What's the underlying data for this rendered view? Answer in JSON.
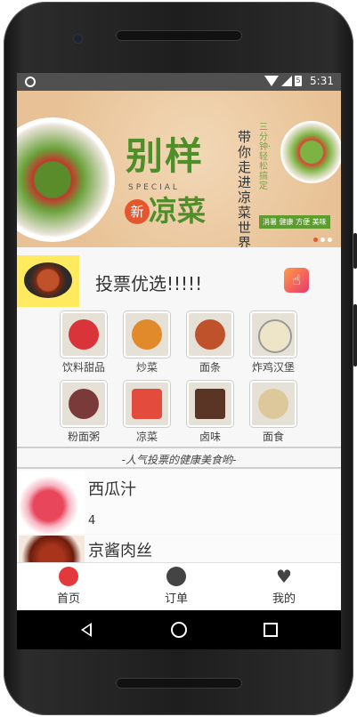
{
  "status_bar": {
    "time": "5:31",
    "battery": "5"
  },
  "banner": {
    "title": "别样",
    "subtitle": "凉菜",
    "special": "SPECIAL",
    "badge": "新",
    "vertical_text": "带你走进凉菜世界",
    "vertical_small": "三分钟·轻松搞定",
    "tag": "消暑 健康 方便 美味"
  },
  "vote": {
    "title": "投票优选!!!!!"
  },
  "categories": [
    {
      "label": "饮料甜品",
      "color": "#d8343a"
    },
    {
      "label": "炒菜",
      "color": "#e08a2c"
    },
    {
      "label": "面条",
      "color": "#c0522b"
    },
    {
      "label": "炸鸡汉堡",
      "color": "#eee5c8"
    },
    {
      "label": "粉面粥",
      "color": "#7a3a3a"
    },
    {
      "label": "凉菜",
      "color": "#e34b3c"
    },
    {
      "label": "卤味",
      "color": "#5a3526"
    },
    {
      "label": "面食",
      "color": "#dcc89a"
    }
  ],
  "popular_caption": "-人气投票的健康美食哟-",
  "items": [
    {
      "name": "西瓜汁",
      "count": "4"
    },
    {
      "name": "京酱肉丝",
      "count": ""
    }
  ],
  "tabs": [
    {
      "label": "首页",
      "color": "#e4393c"
    },
    {
      "label": "订单",
      "color": "#444444"
    },
    {
      "label": "我的",
      "color": "#444444"
    }
  ]
}
